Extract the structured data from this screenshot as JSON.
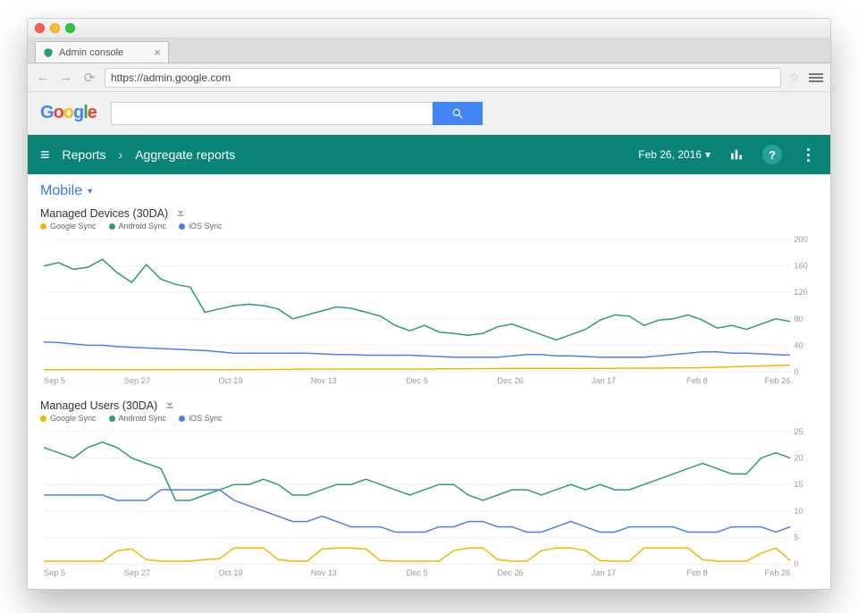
{
  "browser": {
    "tab_title": "Admin console",
    "url": "https://admin.google.com"
  },
  "google_bar": {
    "logo_letters": [
      "G",
      "o",
      "o",
      "g",
      "l",
      "e"
    ],
    "search_value": ""
  },
  "header": {
    "breadcrumb1": "Reports",
    "breadcrumb2": "Aggregate reports",
    "date_label": "Feb 26, 2016"
  },
  "section": {
    "title": "Mobile"
  },
  "legend_labels": {
    "google_sync": "Google Sync",
    "android_sync": "Android Sync",
    "ios_sync": "iOS Sync"
  },
  "colors": {
    "google_sync": "#f4b400",
    "android_sync": "#2e9e6b",
    "ios_sync": "#4b7ef3"
  },
  "x_ticks": [
    "Sep 5",
    "Sep 27",
    "Oct 19",
    "Nov 13",
    "Dec 5",
    "Dec 26",
    "Jan 17",
    "Feb 8",
    "Feb 26"
  ],
  "charts": [
    {
      "title": "Managed Devices (30DA)",
      "ylim": [
        0,
        200
      ],
      "y_ticks": [
        0,
        40,
        80,
        120,
        160,
        200
      ]
    },
    {
      "title": "Managed Users (30DA)",
      "ylim": [
        0,
        25
      ],
      "y_ticks": [
        0,
        5,
        10,
        15,
        20,
        25
      ]
    }
  ],
  "chart_data": [
    {
      "type": "line",
      "title": "Managed Devices (30DA)",
      "xlabel": "",
      "ylabel": "",
      "ylim": [
        0,
        200
      ],
      "categories": [
        "Sep 5",
        "Sep 27",
        "Oct 19",
        "Nov 13",
        "Dec 5",
        "Dec 26",
        "Jan 17",
        "Feb 8",
        "Feb 26"
      ],
      "series": [
        {
          "name": "Google Sync",
          "color": "#f4b400",
          "values": [
            3,
            3,
            3,
            4,
            4,
            5,
            5,
            6,
            10
          ]
        },
        {
          "name": "Android Sync",
          "color": "#2e9e6b",
          "values": [
            160,
            165,
            155,
            158,
            170,
            150,
            135,
            162,
            140,
            132,
            128,
            90,
            95,
            100,
            102,
            100,
            95,
            80,
            86,
            92,
            98,
            96,
            90,
            84,
            70,
            62,
            70,
            60,
            58,
            55,
            58,
            68,
            72,
            64,
            56,
            48,
            56,
            64,
            78,
            86,
            84,
            70,
            78,
            80,
            86,
            78,
            66,
            70,
            64,
            72,
            80,
            76
          ]
        },
        {
          "name": "iOS Sync",
          "color": "#4b7ef3",
          "values": [
            45,
            44,
            42,
            40,
            40,
            38,
            37,
            36,
            35,
            34,
            33,
            32,
            30,
            28,
            28,
            28,
            28,
            28,
            28,
            27,
            26,
            26,
            25,
            25,
            25,
            25,
            24,
            23,
            22,
            22,
            22,
            22,
            24,
            26,
            26,
            24,
            24,
            23,
            22,
            22,
            22,
            22,
            24,
            26,
            28,
            30,
            30,
            28,
            28,
            27,
            26,
            25
          ]
        }
      ]
    },
    {
      "type": "line",
      "title": "Managed Users (30DA)",
      "xlabel": "",
      "ylabel": "",
      "ylim": [
        0,
        25
      ],
      "categories": [
        "Sep 5",
        "Sep 27",
        "Oct 19",
        "Nov 13",
        "Dec 5",
        "Dec 26",
        "Jan 17",
        "Feb 8",
        "Feb 26"
      ],
      "series": [
        {
          "name": "Google Sync",
          "color": "#f4b400",
          "values": [
            0.5,
            0.5,
            0.5,
            0.5,
            0.5,
            2.5,
            2.8,
            0.8,
            0.5,
            0.5,
            0.5,
            0.8,
            1.0,
            3.0,
            3.0,
            3.0,
            0.8,
            0.5,
            0.5,
            2.8,
            3.0,
            3.0,
            2.8,
            0.6,
            0.5,
            0.5,
            0.5,
            0.5,
            2.5,
            3.0,
            3.0,
            0.8,
            0.5,
            0.5,
            2.5,
            3.0,
            3.0,
            2.5,
            0.6,
            0.5,
            0.5,
            3.0,
            3.0,
            3.0,
            3.0,
            0.8,
            0.5,
            0.5,
            0.5,
            2.0,
            3.0,
            0.6
          ]
        },
        {
          "name": "Android Sync",
          "color": "#2e9e6b",
          "values": [
            22,
            21,
            20,
            22,
            23,
            22,
            20,
            19,
            18,
            12,
            12,
            13,
            14,
            15,
            15,
            16,
            15,
            13,
            13,
            14,
            15,
            15,
            16,
            15,
            14,
            13,
            14,
            15,
            15,
            13,
            12,
            13,
            14,
            14,
            13,
            14,
            15,
            14,
            15,
            14,
            14,
            15,
            16,
            17,
            18,
            19,
            18,
            17,
            17,
            20,
            21,
            20
          ]
        },
        {
          "name": "iOS Sync",
          "color": "#4b7ef3",
          "values": [
            13,
            13,
            13,
            13,
            13,
            12,
            12,
            12,
            14,
            14,
            14,
            14,
            14,
            12,
            11,
            10,
            9,
            8,
            8,
            9,
            8,
            7,
            7,
            7,
            6,
            6,
            6,
            7,
            7,
            8,
            8,
            7,
            7,
            6,
            6,
            7,
            8,
            7,
            6,
            6,
            7,
            7,
            7,
            7,
            6,
            6,
            6,
            7,
            7,
            7,
            6,
            7
          ]
        }
      ]
    }
  ]
}
